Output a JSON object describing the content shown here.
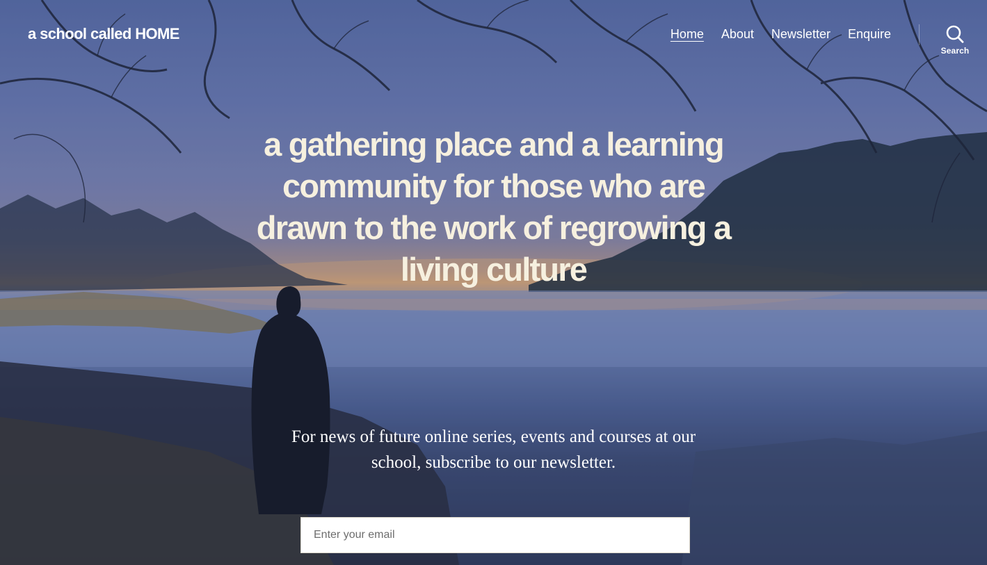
{
  "header": {
    "site_title": "a school called HOME",
    "nav": [
      {
        "label": "Home",
        "current": true
      },
      {
        "label": "About",
        "current": false
      },
      {
        "label": "Newsletter",
        "current": false
      },
      {
        "label": "Enquire",
        "current": false
      }
    ],
    "search_label": "Search",
    "search_icon": "search-icon"
  },
  "hero": {
    "headline": "a gathering place and a learning community for those who are drawn to the work of regrowing a living culture"
  },
  "subscribe": {
    "text": "For news of future online series, events and courses at our school, subscribe to our newsletter.",
    "email_placeholder": "Enter your email",
    "email_value": ""
  },
  "colors": {
    "headline": "#f6f0df",
    "nav_text": "#ffffff",
    "input_background": "#ffffff"
  }
}
